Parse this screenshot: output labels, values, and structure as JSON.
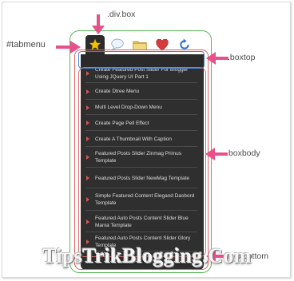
{
  "labels": {
    "div_box": ".div.box",
    "tabmenu": "#tabmenu",
    "boxtop": ".boxtop",
    "boxbody": ".boxbody",
    "boxbottom": ".boxbottom"
  },
  "tabs": [
    {
      "icon": "star-icon",
      "active": true
    },
    {
      "icon": "speech-bubble-icon",
      "active": false
    },
    {
      "icon": "folder-icon",
      "active": false
    },
    {
      "icon": "heart-icon",
      "active": false
    },
    {
      "icon": "refresh-icon",
      "active": false
    }
  ],
  "posts": [
    "Create Featured Post Slider For Blogger Using JQuery UI Part 1",
    "Create Dtree Menu",
    "Multi Level Drop-Down Menu",
    "Create Page Pell Effect",
    "Create A Thumbnail With Caption",
    "Featured Posts Slider Zinmag Primus Template",
    "Featured Posts Slider NewMag Template",
    "Simple Featured Content Elegand Dasbord Template",
    "Featured Auto Posts Content Slider Blue Mania Template",
    "Featured Auto Posts Content Slider Glory Template"
  ],
  "watermark": "TipsTrikBlogging.Com",
  "colors": {
    "panel": "#2f2f2f",
    "bullet": "#d9534f",
    "label_arrow": "#e8508a",
    "outline_green": "#5cb85c",
    "outline_red": "#e06060",
    "outline_blue": "#4a7fd0"
  }
}
